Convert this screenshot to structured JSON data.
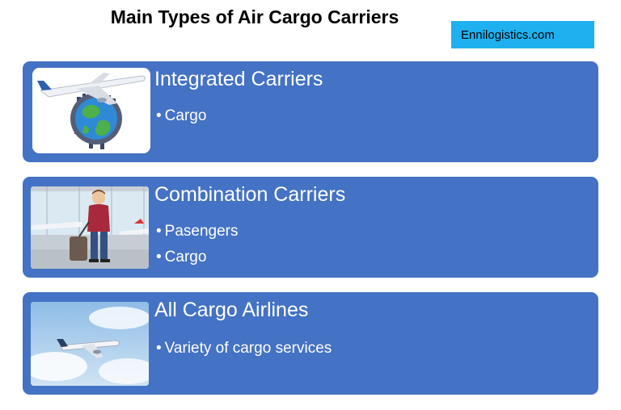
{
  "header": {
    "title": "Main Types of Air Cargo Carriers",
    "brand": "Ennilogistics.com"
  },
  "cards": [
    {
      "title": "Integrated Carriers",
      "bullets": [
        "Cargo"
      ],
      "image_icon": "plane-over-globe-icon"
    },
    {
      "title": "Combination Carriers",
      "bullets": [
        "Pasengers",
        "Cargo"
      ],
      "image_icon": "traveler-at-airport-icon"
    },
    {
      "title": "All Cargo Airlines",
      "bullets": [
        "Variety of cargo services"
      ],
      "image_icon": "plane-in-sky-icon"
    }
  ],
  "colors": {
    "card": "#4472c4",
    "brand_box": "#1fb0ef",
    "text_on_card": "#ffffff"
  }
}
